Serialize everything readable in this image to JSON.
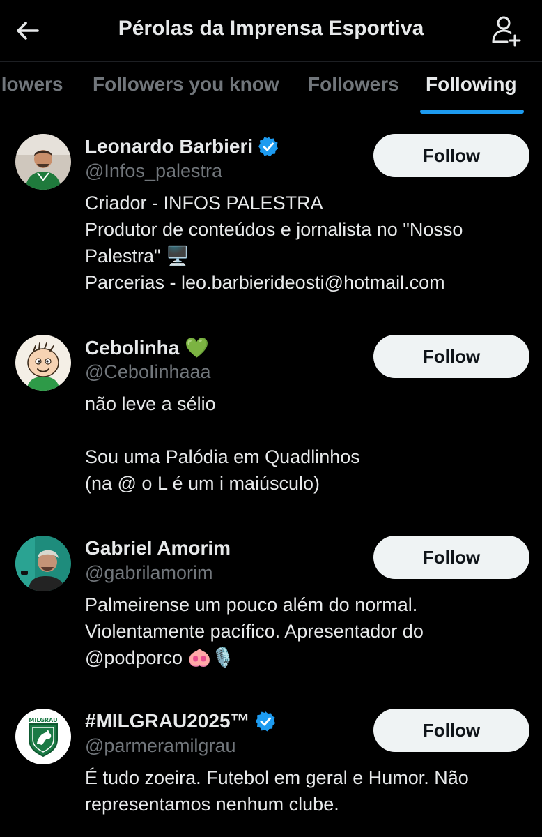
{
  "header": {
    "title": "Pérolas da Imprensa Esportiva",
    "back_icon": "arrow-left-icon",
    "add_icon": "add-user-icon"
  },
  "tabs": [
    {
      "label": "llowers",
      "active": false
    },
    {
      "label": "Followers you know",
      "active": false
    },
    {
      "label": "Followers",
      "active": false
    },
    {
      "label": "Following",
      "active": true
    }
  ],
  "colors": {
    "background": "#000000",
    "text": "#e7e9ea",
    "muted": "#71767b",
    "accent": "#1d9bf0",
    "button_bg": "#eff3f4"
  },
  "users": [
    {
      "name": "Leonardo Barbieri",
      "verified": true,
      "handle": "@Infos_palestra",
      "follow_label": "Follow",
      "bio": [
        "Criador - INFOS PALESTRA",
        "Produtor de conteúdos e jornalista no \"Nosso",
        "Palestra\" 🖥️",
        "Parcerias - leo.barbierideosti@hotmail.com"
      ]
    },
    {
      "name": "Cebolinha 💚",
      "verified": false,
      "handle": "@CeboIinhaaa",
      "follow_label": "Follow",
      "bio": [
        "não leve a sélio",
        "",
        "Sou uma Palódia em Quadlinhos",
        "(na @ o L é um i maiúsculo)"
      ]
    },
    {
      "name": "Gabriel Amorim",
      "verified": false,
      "handle": "@gabrilamorim",
      "follow_label": "Follow",
      "bio": [
        "Palmeirense um pouco além do normal.",
        "Violentamente pacífico. Apresentador do",
        "@podporco 🐽🎙️"
      ]
    },
    {
      "name": "#MILGRAU2025™",
      "verified": true,
      "handle": "@parmeramilgrau",
      "follow_label": "Follow",
      "bio": [
        "É tudo zoeira. Futebol em geral e Humor. Não",
        "representamos nenhum clube."
      ],
      "logo_text": "MILGRAU"
    }
  ]
}
